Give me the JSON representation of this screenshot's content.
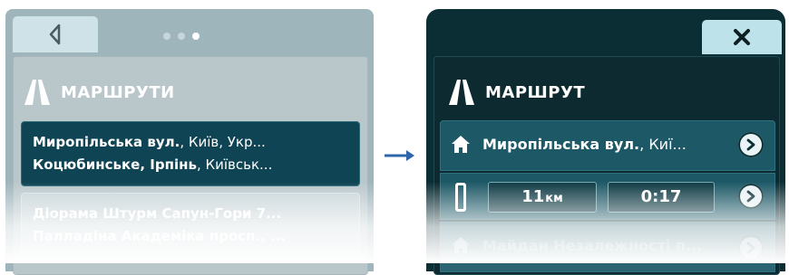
{
  "left_screen": {
    "pager_total": 3,
    "pager_active": 3,
    "title": "МАРШРУТИ",
    "routes": [
      {
        "line1_bold": "Миропільська вул.",
        "line1_rest": ", Київ, Укр...",
        "line2_bold": "Коцюбинське, Ірпінь",
        "line2_rest": ", Київськ..."
      },
      {
        "line1_bold": "Діорама Штурм Сапун-Гори 7...",
        "line1_rest": "",
        "line2_bold": "Палладіна Академіка просп., ...",
        "line2_rest": ""
      }
    ]
  },
  "right_screen": {
    "title": "МАРШРУТ",
    "from_bold": "Миропільська вул.",
    "from_rest": ", Киї...",
    "distance_value": "11",
    "distance_unit": "км",
    "duration": "0:17",
    "next_label": "Майдан Незалежності п..."
  },
  "colors": {
    "left_bg": "#9fb5bc",
    "right_bg": "#0b2e35",
    "selected_card": "#0e4453",
    "row_bg": "#1d5866",
    "arrow": "#2e64a8"
  },
  "icons": [
    "back-arrow-icon",
    "road-icon",
    "transition-arrow-icon",
    "close-icon",
    "home-icon",
    "chevron-right-icon"
  ]
}
